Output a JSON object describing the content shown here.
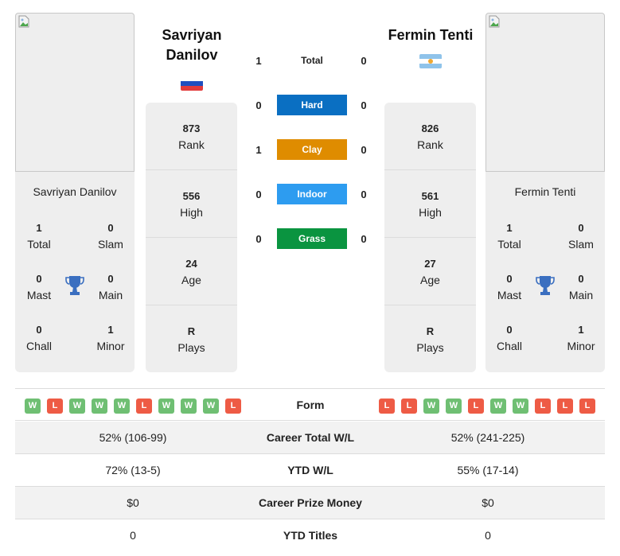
{
  "players": {
    "left": {
      "name": "Savriyan Danilov",
      "name_line1": "Savriyan",
      "name_line2": "Danilov",
      "country_flag": "russia-flag",
      "flag_colors": [
        "#ffffff",
        "#1f4fbf",
        "#e23b3b"
      ],
      "rank": "873",
      "high": "556",
      "age": "24",
      "plays": "R",
      "titles": {
        "total": "1",
        "slam": "0",
        "mast": "0",
        "main": "0",
        "chall": "0",
        "minor": "1"
      },
      "form": [
        "W",
        "L",
        "W",
        "W",
        "W",
        "L",
        "W",
        "W",
        "W",
        "L"
      ]
    },
    "right": {
      "name": "Fermin Tenti",
      "country_flag": "argentina-flag",
      "flag_colors": [
        "#8fc3ea",
        "#ffffff",
        "#8fc3ea"
      ],
      "rank": "826",
      "high": "561",
      "age": "27",
      "plays": "R",
      "titles": {
        "total": "1",
        "slam": "0",
        "mast": "0",
        "main": "0",
        "chall": "0",
        "minor": "1"
      },
      "form": [
        "L",
        "L",
        "W",
        "W",
        "L",
        "W",
        "W",
        "L",
        "L",
        "L"
      ]
    }
  },
  "labels": {
    "rank": "Rank",
    "high": "High",
    "age": "Age",
    "plays": "Plays",
    "total": "Total",
    "slam": "Slam",
    "mast": "Mast",
    "main": "Main",
    "chall": "Chall",
    "minor": "Minor"
  },
  "h2h": [
    {
      "label": "Total",
      "left": "1",
      "right": "0",
      "color": ""
    },
    {
      "label": "Hard",
      "left": "0",
      "right": "0",
      "color": "#0a6fc2"
    },
    {
      "label": "Clay",
      "left": "1",
      "right": "0",
      "color": "#df8c00"
    },
    {
      "label": "Indoor",
      "left": "0",
      "right": "0",
      "color": "#2d9cf0"
    },
    {
      "label": "Grass",
      "left": "0",
      "right": "0",
      "color": "#0a9440"
    }
  ],
  "comparison": {
    "form_label": "Form",
    "rows": [
      {
        "label": "Career Total W/L",
        "left": "52% (106-99)",
        "right": "52% (241-225)"
      },
      {
        "label": "YTD W/L",
        "left": "72% (13-5)",
        "right": "55% (17-14)"
      },
      {
        "label": "Career Prize Money",
        "left": "$0",
        "right": "$0"
      },
      {
        "label": "YTD Titles",
        "left": "0",
        "right": "0"
      }
    ]
  },
  "colors": {
    "win": "#6fbf73",
    "loss": "#ee5b45",
    "trophy": "#3a6fc0",
    "card": "#eeeeee"
  }
}
